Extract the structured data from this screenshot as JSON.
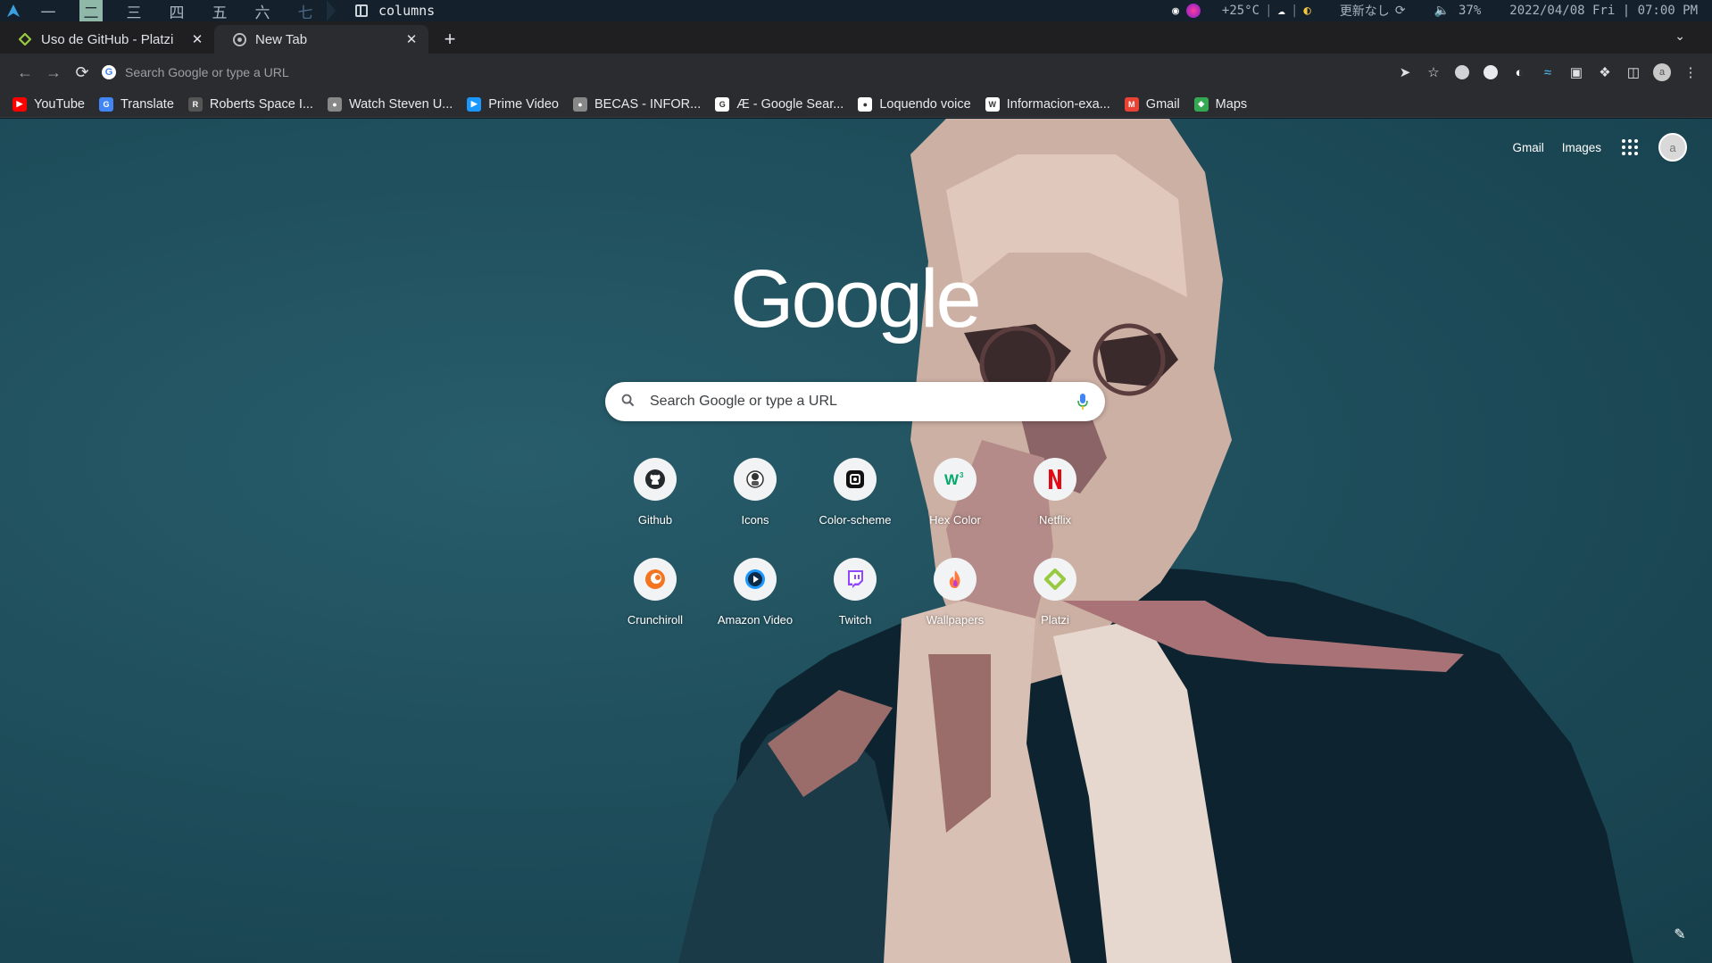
{
  "wm": {
    "workspaces": [
      "一",
      "二",
      "三",
      "四",
      "五",
      "六",
      "七"
    ],
    "active_workspace": 1,
    "layout_label": "columns",
    "weather": "+25°C",
    "update_status": "更新なし",
    "volume": "37%",
    "datetime": "2022/04/08 Fri | 07:00 PM"
  },
  "tabs": [
    {
      "title": "Uso de GitHub - Platzi",
      "icon": "platzi-icon",
      "active": false
    },
    {
      "title": "New Tab",
      "icon": "chrome-icon",
      "active": true
    }
  ],
  "omnibox": {
    "placeholder": "Search Google or type a URL"
  },
  "bookmarks": [
    {
      "label": "YouTube",
      "icon": "youtube-icon",
      "color": "#ff0000"
    },
    {
      "label": "Translate",
      "icon": "translate-icon",
      "color": "#4285f4"
    },
    {
      "label": "Roberts Space I...",
      "icon": "rsi-icon",
      "color": "#555555"
    },
    {
      "label": "Watch Steven U...",
      "icon": "globe-icon",
      "color": "#888888"
    },
    {
      "label": "Prime Video",
      "icon": "prime-video-icon",
      "color": "#1a98ff"
    },
    {
      "label": "BECAS - INFOR...",
      "icon": "globe-icon",
      "color": "#888888"
    },
    {
      "label": "Æ - Google Sear...",
      "icon": "google-icon",
      "color": "#ffffff"
    },
    {
      "label": "Loquendo voice",
      "icon": "chat-icon",
      "color": "#ffffff"
    },
    {
      "label": "Informacion-exa...",
      "icon": "wordpress-icon",
      "color": "#ffffff"
    },
    {
      "label": "Gmail",
      "icon": "gmail-icon",
      "color": "#ea4335"
    },
    {
      "label": "Maps",
      "icon": "maps-icon",
      "color": "#34a853"
    }
  ],
  "ntp": {
    "gmail_link": "Gmail",
    "images_link": "Images",
    "avatar_letter": "a",
    "logo_text": "Google",
    "search_placeholder": "Search Google or type a URL",
    "shortcuts": [
      {
        "label": "Github",
        "icon": "github-icon"
      },
      {
        "label": "Icons",
        "icon": "icons-site-icon"
      },
      {
        "label": "Color-scheme",
        "icon": "color-scheme-icon"
      },
      {
        "label": "Hex Color",
        "icon": "w3-icon"
      },
      {
        "label": "Netflix",
        "icon": "netflix-icon"
      },
      {
        "label": "Crunchiroll",
        "icon": "crunchyroll-icon"
      },
      {
        "label": "Amazon Video",
        "icon": "amazon-video-icon"
      },
      {
        "label": "Twitch",
        "icon": "twitch-icon"
      },
      {
        "label": "Wallpapers",
        "icon": "wallpapers-icon"
      },
      {
        "label": "Platzi",
        "icon": "platzi-icon"
      }
    ]
  },
  "colors": {
    "wm_bar": "#14212c",
    "tab_strip": "#1f1f22",
    "toolbar": "#2b2c30",
    "ntp_background": "#1f4e5c",
    "accent_green": "#98ca3f"
  }
}
